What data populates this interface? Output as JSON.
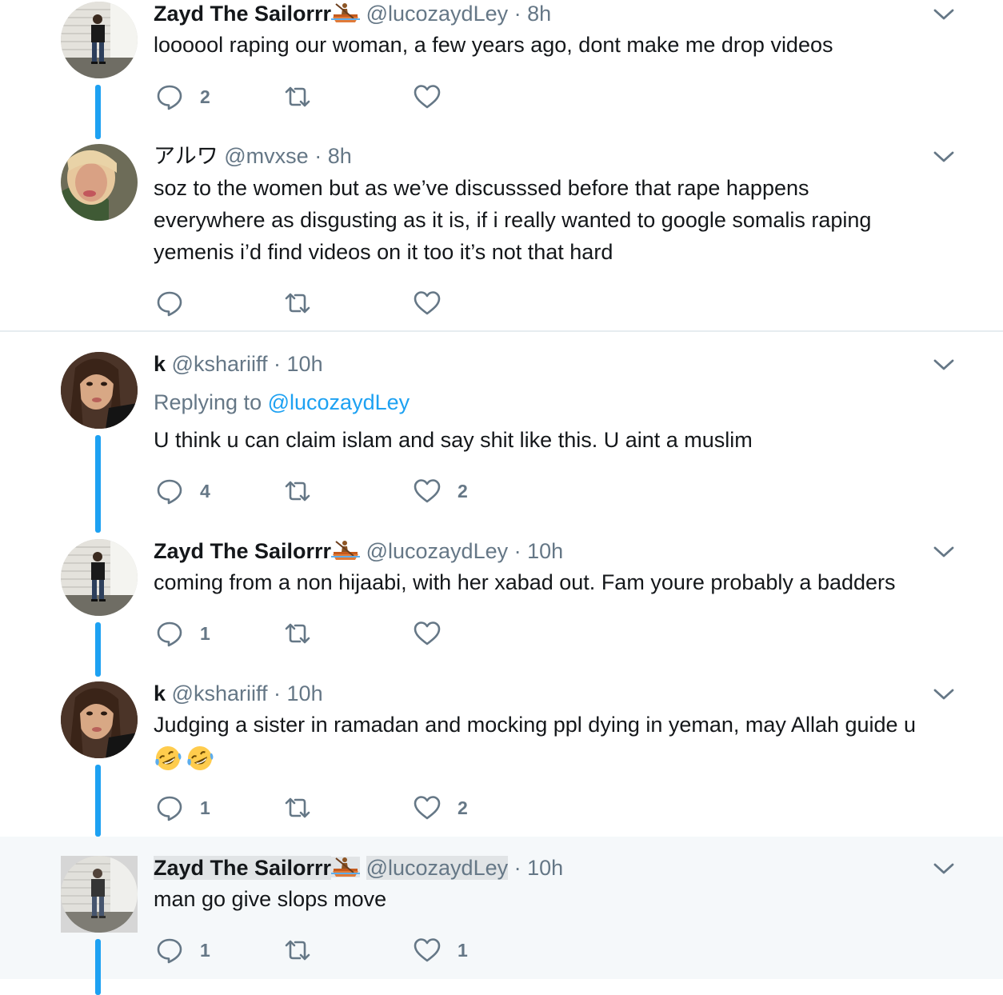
{
  "tweets": [
    {
      "name": "Zayd The Sailorrr",
      "handle": "@lucozaydLey",
      "dot": "·",
      "time": "8h",
      "text": "loooool raping our woman, a few years ago, dont make me drop videos",
      "reply_count": "2",
      "retweet_count": "",
      "like_count": ""
    },
    {
      "name": "アルワ",
      "handle": "@mvxse",
      "dot": "·",
      "time": "8h",
      "text_lines": [
        "soz to the women but as we’ve discusssed before that rape happens",
        "everywhere as disgusting as it is, if i really wanted to google somalis raping",
        "yemenis i’d find videos on it too it’s not that hard"
      ],
      "reply_count": "",
      "retweet_count": "",
      "like_count": ""
    },
    {
      "name": "k",
      "handle": "@kshariiff",
      "dot": "·",
      "time": "10h",
      "replying_label": "Replying to",
      "replying_handle": "@lucozaydLey",
      "text": "U think u can claim islam and say shit like this. U aint a muslim",
      "reply_count": "4",
      "retweet_count": "",
      "like_count": "2"
    },
    {
      "name": "Zayd The Sailorrr",
      "handle": "@lucozaydLey",
      "dot": "·",
      "time": "10h",
      "text": "coming from a non hijaabi, with her xabad out. Fam youre probably a badders",
      "reply_count": "1",
      "retweet_count": "",
      "like_count": ""
    },
    {
      "name": "k",
      "handle": "@kshariiff",
      "dot": "·",
      "time": "10h",
      "text": "Judging a sister in ramadan and mocking ppl dying in yeman, may Allah guide u",
      "reply_count": "1",
      "retweet_count": "",
      "like_count": "2"
    },
    {
      "name": "Zayd The Sailorrr",
      "handle": "@lucozaydLey",
      "dot": "·",
      "time": "10h",
      "text": "man go give slops move",
      "reply_count": "1",
      "retweet_count": "",
      "like_count": "1"
    }
  ],
  "icons": {
    "reply": "reply-icon",
    "retweet": "retweet-icon",
    "like": "heart-icon",
    "caret": "chevron-down-icon",
    "boat": "rowboat-emoji",
    "laugh": "rolling-on-floor-laughing-emoji"
  },
  "colors": {
    "accent": "#1da1f2",
    "muted": "#657786",
    "text": "#14171a",
    "highlight_bg": "#f5f8fa"
  }
}
